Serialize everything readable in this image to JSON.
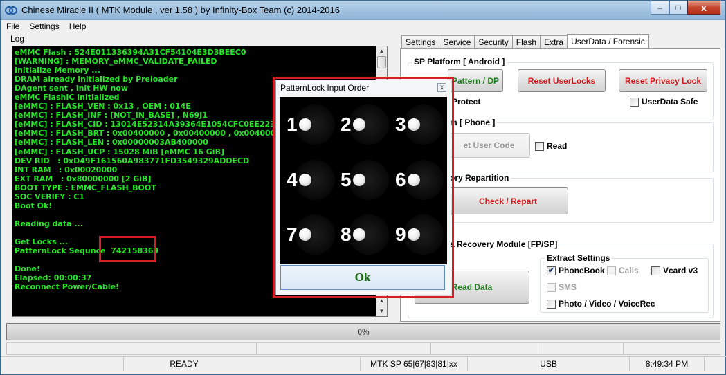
{
  "window": {
    "title": "Chinese Miracle II ( MTK Module , ver 1.58 ) by Infinity-Box Team (c) 2014-2016",
    "minimize": "–",
    "maximize": "□",
    "close": "x"
  },
  "menu": [
    "File",
    "Settings",
    "Help"
  ],
  "log": {
    "label": "Log",
    "lines": [
      "eMMC Flash : 524E011336394A31CF54104E3D3BEEC0",
      "[WARNING] : MEMORY_eMMC_VALIDATE_FAILED",
      "Initialize Memory ...",
      "DRAM already initialized by Preloader",
      "DAgent sent , init HW now",
      "eMMC FlashIC initialized",
      "[eMMC] : FLASH_VEN : 0x13 , OEM : 014E",
      "[eMMC] : FLASH_INF : [NOT_IN_BASE] , N69J1",
      "[eMMC] : FLASH_CID : 13014E52314A39364E1054CFC0EE223D",
      "[eMMC] : FLASH_BRT : 0x00400000 , 0x00400000 , 0x00400000",
      "[eMMC] : FLASH_LEN : 0x00000003AB400000",
      "[eMMC] : FLASH_UCP : 15028 MiB [eMMC 16 GiB]",
      "DEV RID   : 0xD49F161560A983771FD3549329ADDECD",
      "INT RAM   : 0x00020000",
      "EXT RAM   : 0x80000000 [2 GiB]",
      "BOOT TYPE : EMMC_FLASH_BOOT",
      "SOC VERIFY : C1",
      "Boot Ok!",
      "",
      "Reading data ...",
      "",
      "Get Locks ...",
      "PatternLock Sequnce  742158369",
      "",
      "Done!",
      "Elapsed: 00:00:37",
      "Reconnect Power/Cable!"
    ]
  },
  "tabs": [
    "Settings",
    "Service",
    "Security",
    "Flash",
    "Extra",
    "UserData / Forensic"
  ],
  "sp_platform": {
    "title": "SP Platform [ Android ]",
    "pattern_btn": "Pattern / DP",
    "reset_userlocks": "Reset UserLocks",
    "reset_privacy": "Reset Privacy Lock",
    "protect_label": "Protect",
    "userdata_safe": "UserData Safe"
  },
  "phone": {
    "title": "m [ Phone ]",
    "set_user_code": "et User Code",
    "read": "Read"
  },
  "repartition": {
    "title": "ory Repartition",
    "check_btn": "Check / Repart"
  },
  "recovery": {
    "title": "a Recovery Module  [FP/SP]",
    "read_btn": "Read Data",
    "extract_title": "Extract Settings",
    "phonebook": "PhoneBook",
    "calls": "Calls",
    "vcard": "Vcard v3",
    "sms": "SMS",
    "photo": "Photo / Video / VoiceRec",
    "check_mark": "✔"
  },
  "progress": {
    "text": "0%",
    "value": 0
  },
  "statusbar": {
    "state": "READY",
    "platform": "MTK SP 65|67|83|81|xx",
    "conn": "USB",
    "time": "8:49:34 PM"
  },
  "dialog": {
    "title": "PatternLock Input Order",
    "close": "x",
    "numbers": [
      "1",
      "2",
      "3",
      "4",
      "5",
      "6",
      "7",
      "8",
      "9"
    ],
    "ok": "Ok"
  },
  "colors": {
    "log_text": "#26e526",
    "highlight": "#d41f26",
    "danger_text": "#d01a1a",
    "ok_text": "#1d6e12"
  }
}
